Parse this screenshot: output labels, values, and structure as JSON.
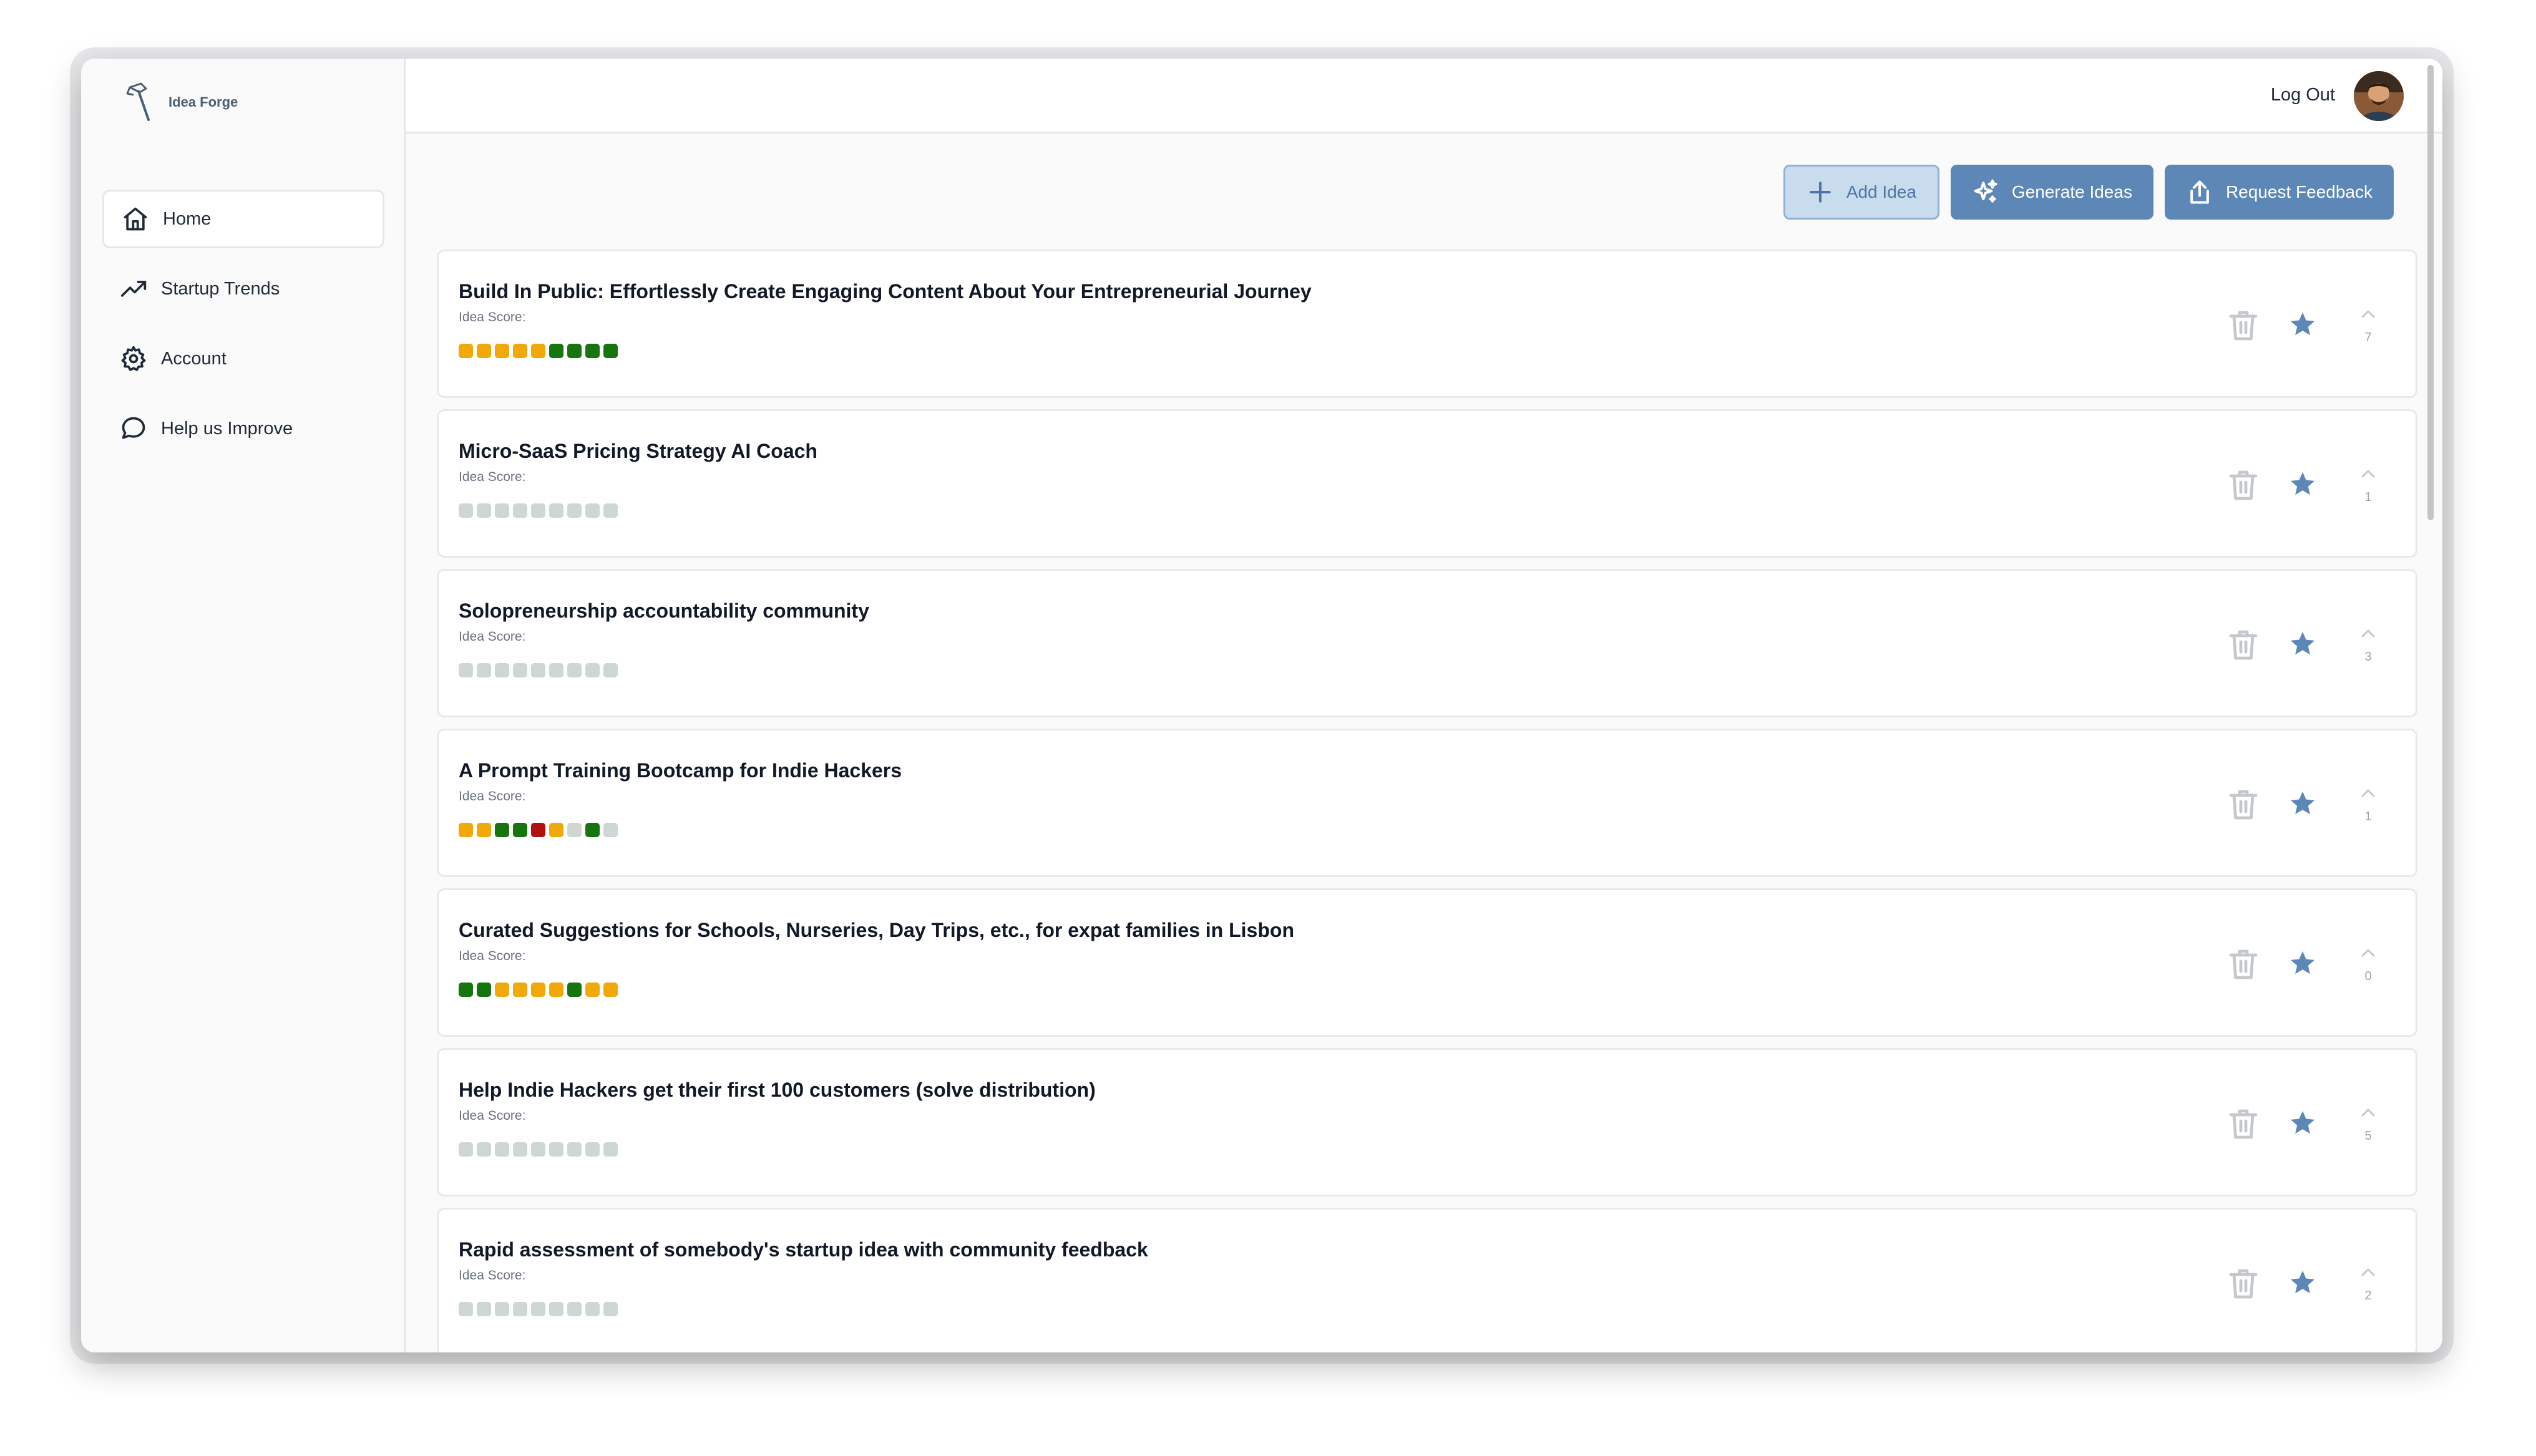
{
  "brand": {
    "name": "Idea Forge"
  },
  "nav": [
    {
      "label": "Home",
      "icon": "home-icon",
      "active": true
    },
    {
      "label": "Startup Trends",
      "icon": "trending-up-icon"
    },
    {
      "label": "Account",
      "icon": "gear-icon"
    },
    {
      "label": "Help us Improve",
      "icon": "chat-bubble-icon"
    }
  ],
  "header": {
    "logout_label": "Log Out"
  },
  "actions": {
    "add_label": "Add Idea",
    "generate_label": "Generate Ideas",
    "feedback_label": "Request Feedback"
  },
  "colors": {
    "accent": "#5d87b6",
    "score_yellow": "#f1a90a",
    "score_green": "#17750f",
    "score_red": "#b01212",
    "score_empty": "#cfd7d3"
  },
  "score_label": "Idea Score:",
  "ideas": [
    {
      "title": "Build In Public: Effortlessly Create Engaging Content About Your Entrepreneurial Journey",
      "score": [
        "y",
        "y",
        "y",
        "y",
        "y",
        "g",
        "g",
        "g",
        "g"
      ],
      "votes": "7"
    },
    {
      "title": "Micro-SaaS Pricing Strategy AI Coach",
      "score": [
        "n",
        "n",
        "n",
        "n",
        "n",
        "n",
        "n",
        "n",
        "n"
      ],
      "votes": "1"
    },
    {
      "title": "Solopreneurship accountability community",
      "score": [
        "n",
        "n",
        "n",
        "n",
        "n",
        "n",
        "n",
        "n",
        "n"
      ],
      "votes": "3"
    },
    {
      "title": "A Prompt Training Bootcamp for Indie Hackers",
      "score": [
        "y",
        "y",
        "g",
        "g",
        "r",
        "y",
        "n",
        "g",
        "n"
      ],
      "votes": "1"
    },
    {
      "title": "Curated Suggestions for Schools, Nurseries, Day Trips, etc., for expat families in Lisbon",
      "score": [
        "g",
        "g",
        "y",
        "y",
        "y",
        "y",
        "g",
        "y",
        "y"
      ],
      "votes": "0"
    },
    {
      "title": "Help Indie Hackers get their first 100 customers (solve distribution)",
      "score": [
        "n",
        "n",
        "n",
        "n",
        "n",
        "n",
        "n",
        "n",
        "n"
      ],
      "votes": "5"
    },
    {
      "title": "Rapid assessment of somebody's startup idea with community feedback",
      "score": [
        "n",
        "n",
        "n",
        "n",
        "n",
        "n",
        "n",
        "n",
        "n"
      ],
      "votes": "2"
    }
  ]
}
